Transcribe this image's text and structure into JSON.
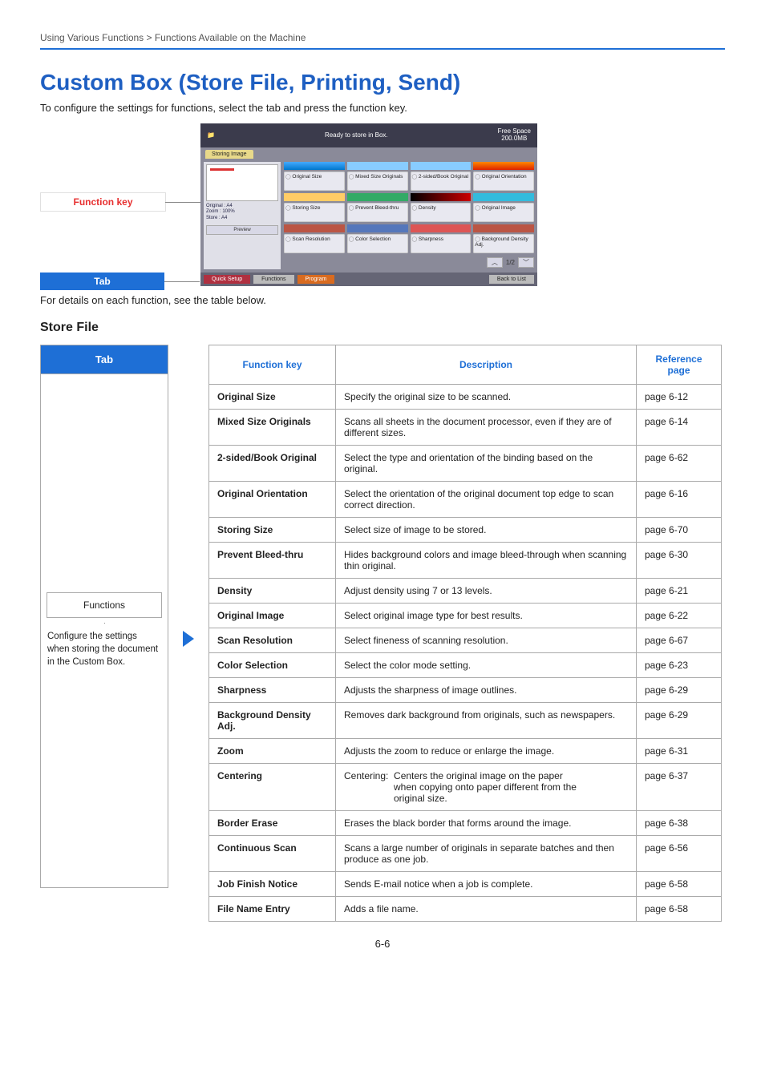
{
  "breadcrumb": "Using Various Functions > Functions Available on the Machine",
  "title": "Custom Box (Store File, Printing, Send)",
  "intro": "To configure the settings for functions, select the tab and press the function key.",
  "label_function_key": "Function key",
  "label_tab": "Tab",
  "screen": {
    "header_text": "Ready to store in Box.",
    "free_space_label": "Free Space",
    "free_space_value": "200.0MB",
    "storing_image_tab": "Storing Image",
    "preview_meta_original": "Original",
    "preview_meta_original_v": ": A4",
    "preview_meta_zoom": "Zoom",
    "preview_meta_zoom_v": ": 100%",
    "preview_meta_store": "Store",
    "preview_meta_store_v": ": A4",
    "preview_btn": "Preview",
    "btns_row1": [
      "Original Size",
      "Mixed Size Originals",
      "2-sided/Book Original",
      "Original Orientation"
    ],
    "btns_row2": [
      "Storing Size",
      "Prevent Bleed-thru",
      "Density",
      "Original Image"
    ],
    "btns_row3": [
      "Scan Resolution",
      "Color Selection",
      "Sharpness",
      "Background Density Adj."
    ],
    "pager": "1/2",
    "footer_setup": "Quick Setup",
    "footer_functions": "Functions",
    "footer_program": "Program",
    "footer_back": "Back to List"
  },
  "below": "For details on each function, see the table below.",
  "section": "Store File",
  "left": {
    "tab_header": "Tab",
    "functions_pane": "Functions",
    "functions_desc": "Configure the settings when storing the document in the Custom Box."
  },
  "table": {
    "h_fn": "Function key",
    "h_desc": "Description",
    "h_ref": "Reference page",
    "rows": [
      {
        "fn": "Original Size",
        "desc": "Specify the original size to be scanned.",
        "ref": "page 6-12"
      },
      {
        "fn": "Mixed Size Originals",
        "desc": "Scans all sheets in the document processor, even if they are of different sizes.",
        "ref": "page 6-14"
      },
      {
        "fn": "2-sided/Book Original",
        "desc": "Select the type and orientation of the binding based on the original.",
        "ref": "page 6-62"
      },
      {
        "fn": "Original Orientation",
        "desc": "Select the orientation of the original document top edge to scan correct direction.",
        "ref": "page 6-16"
      },
      {
        "fn": "Storing Size",
        "desc": "Select size of image to be stored.",
        "ref": "page 6-70"
      },
      {
        "fn": "Prevent Bleed-thru",
        "desc": "Hides background colors and image bleed-through when scanning thin original.",
        "ref": "page 6-30"
      },
      {
        "fn": "Density",
        "desc": "Adjust density using 7 or 13 levels.",
        "ref": "page 6-21"
      },
      {
        "fn": "Original Image",
        "desc": "Select original image type for best results.",
        "ref": "page 6-22"
      },
      {
        "fn": "Scan Resolution",
        "desc": "Select fineness of scanning resolution.",
        "ref": "page 6-67"
      },
      {
        "fn": "Color Selection",
        "desc": "Select the color mode setting.",
        "ref": "page 6-23"
      },
      {
        "fn": "Sharpness",
        "desc": "Adjusts the sharpness of image outlines.",
        "ref": "page 6-29"
      },
      {
        "fn": "Background Density Adj.",
        "desc": "Removes dark background from originals, such as newspapers.",
        "ref": "page 6-29"
      },
      {
        "fn": "Zoom",
        "desc": "Adjusts the zoom to reduce or enlarge the image.",
        "ref": "page 6-31"
      },
      {
        "fn": "Centering",
        "desc": "Centering:   Centers the original image on the paper when copying onto paper different from the original size.",
        "ref": "page 6-37"
      },
      {
        "fn": "Border Erase",
        "desc": "Erases the black border that forms around the image.",
        "ref": "page 6-38"
      },
      {
        "fn": "Continuous Scan",
        "desc": "Scans a large number of originals in separate batches and then produce as one job.",
        "ref": "page 6-56"
      },
      {
        "fn": "Job Finish Notice",
        "desc": "Sends E-mail notice when a job is complete.",
        "ref": "page 6-58"
      },
      {
        "fn": "File Name Entry",
        "desc": "Adds a file name.",
        "ref": "page 6-58"
      }
    ]
  },
  "pagenum": "6-6"
}
